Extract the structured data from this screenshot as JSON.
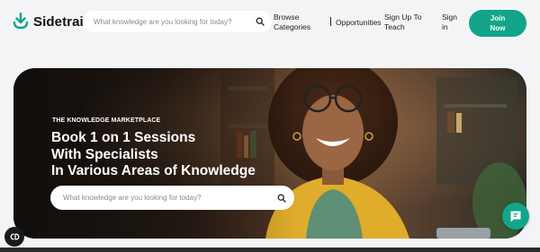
{
  "brand": {
    "name": "Sidetrain",
    "accent": "#12a58a"
  },
  "nav": {
    "search_placeholder": "What knowledge are you looking for today?",
    "browse_line1": "Browse",
    "browse_line2": "Categories",
    "opportunities": "Opportunities",
    "signup_line1": "Sign Up To",
    "signup_line2": "Teach",
    "signin_line1": "Sign",
    "signin_line2": "in",
    "join_line1": "Join",
    "join_line2": "Now"
  },
  "hero": {
    "eyebrow": "THE KNOWLEDGE MARKETPLACE",
    "title_line1": "Book 1 on 1 Sessions",
    "title_line2": "With Specialists",
    "title_line3": "In Various Areas of Knowledge",
    "search_placeholder": "What knowledge are you looking for today?"
  },
  "icons": {
    "logo": "sidetrain-logo-icon",
    "search": "search-icon",
    "cookie": "cookie-settings-icon",
    "chat": "chat-icon"
  }
}
